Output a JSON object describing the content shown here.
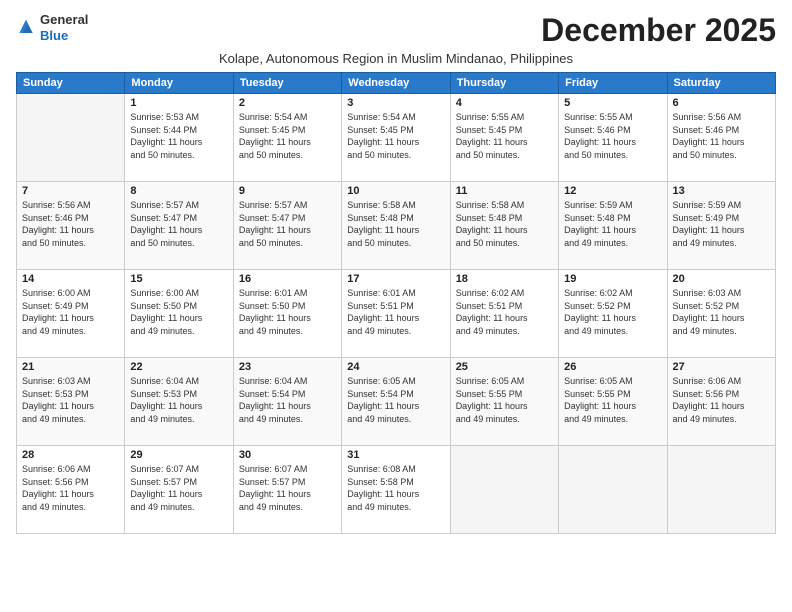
{
  "logo": {
    "general": "General",
    "blue": "Blue"
  },
  "title": "December 2025",
  "subtitle": "Kolape, Autonomous Region in Muslim Mindanao, Philippines",
  "header": {
    "days": [
      "Sunday",
      "Monday",
      "Tuesday",
      "Wednesday",
      "Thursday",
      "Friday",
      "Saturday"
    ]
  },
  "weeks": [
    [
      {
        "day": "",
        "info": ""
      },
      {
        "day": "1",
        "info": "Sunrise: 5:53 AM\nSunset: 5:44 PM\nDaylight: 11 hours\nand 50 minutes."
      },
      {
        "day": "2",
        "info": "Sunrise: 5:54 AM\nSunset: 5:45 PM\nDaylight: 11 hours\nand 50 minutes."
      },
      {
        "day": "3",
        "info": "Sunrise: 5:54 AM\nSunset: 5:45 PM\nDaylight: 11 hours\nand 50 minutes."
      },
      {
        "day": "4",
        "info": "Sunrise: 5:55 AM\nSunset: 5:45 PM\nDaylight: 11 hours\nand 50 minutes."
      },
      {
        "day": "5",
        "info": "Sunrise: 5:55 AM\nSunset: 5:46 PM\nDaylight: 11 hours\nand 50 minutes."
      },
      {
        "day": "6",
        "info": "Sunrise: 5:56 AM\nSunset: 5:46 PM\nDaylight: 11 hours\nand 50 minutes."
      }
    ],
    [
      {
        "day": "7",
        "info": "Sunrise: 5:56 AM\nSunset: 5:46 PM\nDaylight: 11 hours\nand 50 minutes."
      },
      {
        "day": "8",
        "info": "Sunrise: 5:57 AM\nSunset: 5:47 PM\nDaylight: 11 hours\nand 50 minutes."
      },
      {
        "day": "9",
        "info": "Sunrise: 5:57 AM\nSunset: 5:47 PM\nDaylight: 11 hours\nand 50 minutes."
      },
      {
        "day": "10",
        "info": "Sunrise: 5:58 AM\nSunset: 5:48 PM\nDaylight: 11 hours\nand 50 minutes."
      },
      {
        "day": "11",
        "info": "Sunrise: 5:58 AM\nSunset: 5:48 PM\nDaylight: 11 hours\nand 50 minutes."
      },
      {
        "day": "12",
        "info": "Sunrise: 5:59 AM\nSunset: 5:48 PM\nDaylight: 11 hours\nand 49 minutes."
      },
      {
        "day": "13",
        "info": "Sunrise: 5:59 AM\nSunset: 5:49 PM\nDaylight: 11 hours\nand 49 minutes."
      }
    ],
    [
      {
        "day": "14",
        "info": "Sunrise: 6:00 AM\nSunset: 5:49 PM\nDaylight: 11 hours\nand 49 minutes."
      },
      {
        "day": "15",
        "info": "Sunrise: 6:00 AM\nSunset: 5:50 PM\nDaylight: 11 hours\nand 49 minutes."
      },
      {
        "day": "16",
        "info": "Sunrise: 6:01 AM\nSunset: 5:50 PM\nDaylight: 11 hours\nand 49 minutes."
      },
      {
        "day": "17",
        "info": "Sunrise: 6:01 AM\nSunset: 5:51 PM\nDaylight: 11 hours\nand 49 minutes."
      },
      {
        "day": "18",
        "info": "Sunrise: 6:02 AM\nSunset: 5:51 PM\nDaylight: 11 hours\nand 49 minutes."
      },
      {
        "day": "19",
        "info": "Sunrise: 6:02 AM\nSunset: 5:52 PM\nDaylight: 11 hours\nand 49 minutes."
      },
      {
        "day": "20",
        "info": "Sunrise: 6:03 AM\nSunset: 5:52 PM\nDaylight: 11 hours\nand 49 minutes."
      }
    ],
    [
      {
        "day": "21",
        "info": "Sunrise: 6:03 AM\nSunset: 5:53 PM\nDaylight: 11 hours\nand 49 minutes."
      },
      {
        "day": "22",
        "info": "Sunrise: 6:04 AM\nSunset: 5:53 PM\nDaylight: 11 hours\nand 49 minutes."
      },
      {
        "day": "23",
        "info": "Sunrise: 6:04 AM\nSunset: 5:54 PM\nDaylight: 11 hours\nand 49 minutes."
      },
      {
        "day": "24",
        "info": "Sunrise: 6:05 AM\nSunset: 5:54 PM\nDaylight: 11 hours\nand 49 minutes."
      },
      {
        "day": "25",
        "info": "Sunrise: 6:05 AM\nSunset: 5:55 PM\nDaylight: 11 hours\nand 49 minutes."
      },
      {
        "day": "26",
        "info": "Sunrise: 6:05 AM\nSunset: 5:55 PM\nDaylight: 11 hours\nand 49 minutes."
      },
      {
        "day": "27",
        "info": "Sunrise: 6:06 AM\nSunset: 5:56 PM\nDaylight: 11 hours\nand 49 minutes."
      }
    ],
    [
      {
        "day": "28",
        "info": "Sunrise: 6:06 AM\nSunset: 5:56 PM\nDaylight: 11 hours\nand 49 minutes."
      },
      {
        "day": "29",
        "info": "Sunrise: 6:07 AM\nSunset: 5:57 PM\nDaylight: 11 hours\nand 49 minutes."
      },
      {
        "day": "30",
        "info": "Sunrise: 6:07 AM\nSunset: 5:57 PM\nDaylight: 11 hours\nand 49 minutes."
      },
      {
        "day": "31",
        "info": "Sunrise: 6:08 AM\nSunset: 5:58 PM\nDaylight: 11 hours\nand 49 minutes."
      },
      {
        "day": "",
        "info": ""
      },
      {
        "day": "",
        "info": ""
      },
      {
        "day": "",
        "info": ""
      }
    ]
  ]
}
